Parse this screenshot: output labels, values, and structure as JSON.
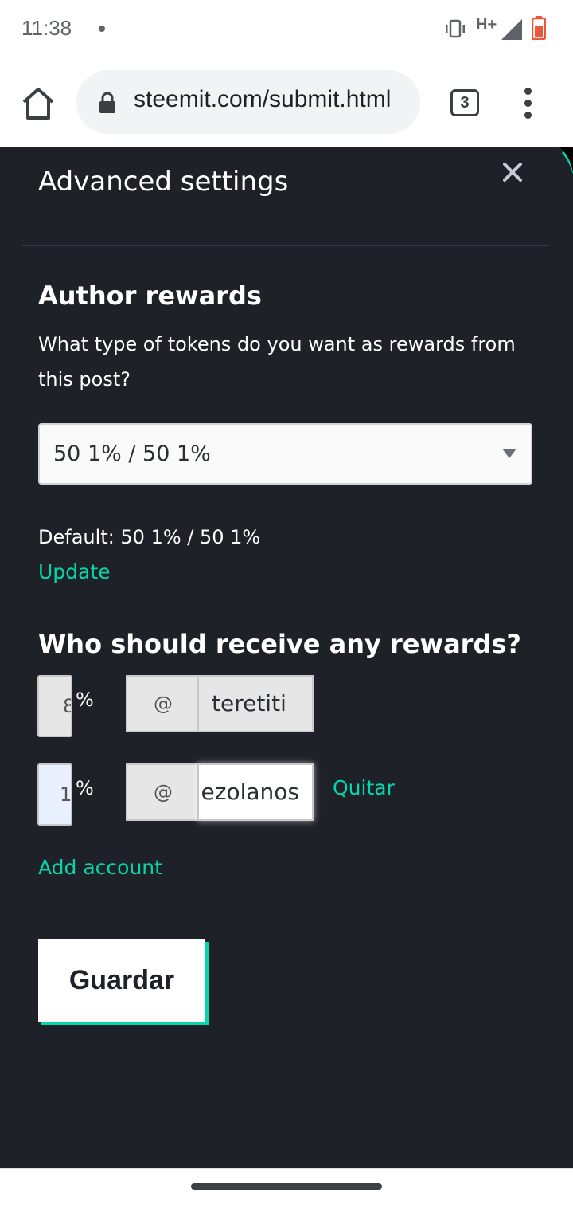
{
  "status": {
    "time": "11:38",
    "network": "H+"
  },
  "browser": {
    "url": "steemit.com/submit.html",
    "tab_count": "3"
  },
  "modal": {
    "title": "Advanced settings",
    "author_rewards": {
      "heading": "Author rewards",
      "question": "What type of tokens do you want as rewards from this post?",
      "selected_option": "50 1% / 50 1%",
      "default_label": "Default: 50 1% / 50 1%",
      "update_link": "Update"
    },
    "beneficiaries": {
      "heading": "Who should receive any rewards?",
      "rows": [
        {
          "percent": "8",
          "at": "@",
          "account": "teretiti",
          "remove": ""
        },
        {
          "percent": "1",
          "at": "@",
          "account": "ezolanos",
          "remove": "Quitar"
        }
      ],
      "percent_sign": "%",
      "add_account": "Add account"
    },
    "save_label": "Guardar"
  },
  "colors": {
    "accent": "#06d6a9",
    "background": "#1e2228"
  }
}
